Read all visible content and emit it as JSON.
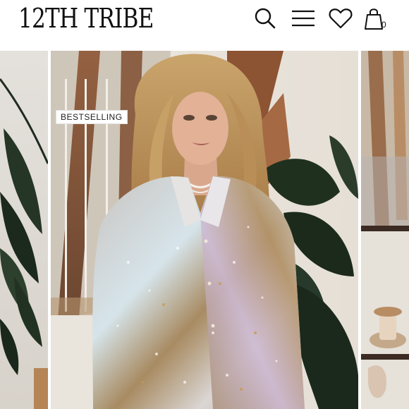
{
  "brand": {
    "logo_text": "12TH TRIBE"
  },
  "header": {
    "icons": [
      "search-icon",
      "menu-icon",
      "heart-icon",
      "shopping-bag-icon"
    ],
    "cart_count": "0"
  },
  "product": {
    "badge": "BESTSELLING"
  },
  "colors": {
    "text": "#111111",
    "badge_bg": "#ffffff",
    "page_bg": "#ffffff"
  }
}
